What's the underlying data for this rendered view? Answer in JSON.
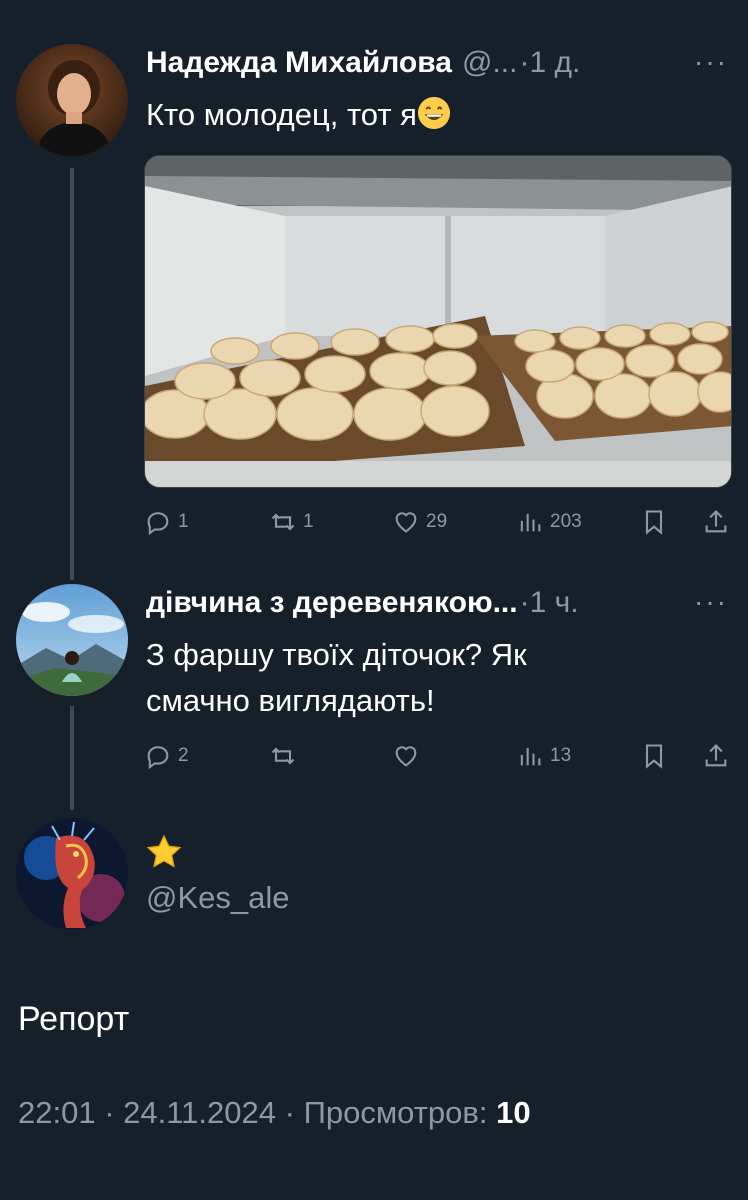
{
  "tweets": [
    {
      "author": "Надежда Михайлова",
      "handle": "@...",
      "time": "·1 д.",
      "more": "···",
      "text": "Кто молодец, тот я",
      "emoji": "grinning-face-emoji",
      "media": "dumplings-in-freezer-photo",
      "stats": {
        "replies": "1",
        "retweets": "1",
        "likes": "29",
        "views": "203"
      }
    },
    {
      "author": "дівчина з деревенякою...",
      "time": "·1 ч.",
      "more": "···",
      "text_line1": "З фаршу твоїх діточок? Як",
      "text_line2": "смачно виглядають!",
      "stats": {
        "replies": "2",
        "retweets": "",
        "likes": "",
        "views": "13"
      }
    }
  ],
  "reply_author": {
    "name_icon": "star-emoji",
    "handle": "@Kes_ale"
  },
  "main_text": "Репорт",
  "timeline": {
    "time": "22:01",
    "sep1": " · ",
    "date": "24.11.2024",
    "sep2": " · ",
    "views_label": "Просмотров: ",
    "views_value": "10"
  },
  "colors": {
    "background": "#15202b",
    "secondary_text": "#8b98a5",
    "thread_line": "#3d4a58"
  }
}
